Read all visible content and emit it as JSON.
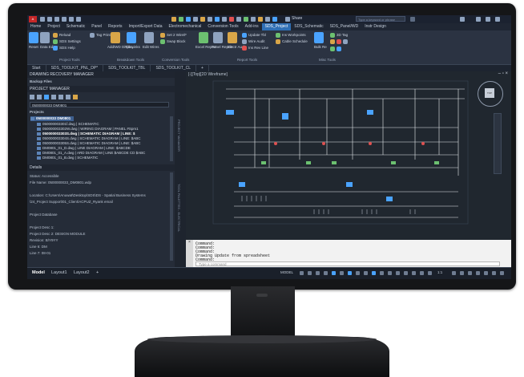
{
  "app": {
    "title_share": "Share",
    "search_placeholder": "Type a keyword or phrase"
  },
  "ribbon_tabs": [
    "Home",
    "Project",
    "Schematic",
    "Panel",
    "Reports",
    "Import/Export Data",
    "Electromechanical",
    "Conversion Tools",
    "Add-ins",
    "SDS_Project",
    "SDS_Schematic",
    "SDS_Panel/WD",
    "Instr Design"
  ],
  "active_ribbon_tab_index": 9,
  "ribbon": {
    "group_titles": [
      "Project Tools",
      "Breakdown Tools",
      "Conversion Tools",
      "Report Tools",
      "Misc Tools"
    ],
    "labels": [
      "Reset",
      "Data Editor",
      "Reload",
      "SDS Settings",
      "SDS Help",
      "Tag Print",
      "Add/WD Display",
      "Tile Links",
      "Edit Wires",
      "Set 2 Wire/F",
      "Swap Block",
      "Excel Report",
      "Panel Report",
      "Electr Audit",
      "Update Tbl",
      "Wire Audit",
      "Ins Rev Line",
      "Ins Workpoints",
      "Cable Schedule",
      "Bulk Re",
      "3D Tag"
    ]
  },
  "doc_tabs": [
    "Start",
    "SDS_TOOLKIT_PNL_DP*",
    "SDS_TOOLKIT_TBL",
    "SDS_TOOLKIT_CL",
    "+"
  ],
  "left_panel": {
    "recovery_title": "DRAWING RECOVERY MANAGER",
    "recovery_label": "Backup Files",
    "project_manager_title": "PROJECT MANAGER",
    "project_dropdown": "0500000033 DM0801",
    "projects_header": "Projects",
    "project_root": "0500000033 DM0801",
    "tree_rows": [
      "050000003301f.dwg | SCHEMATIC",
      "050000003302W.dwg | WIRING DIAGRAM | PANEL #Spm1",
      "050000003303S.dwg | SCHEMATIC DIAGRAM | LINE: $",
      "050000003304S.dwg | SCHEMATIC DIAGRAM | LINE: $ABC",
      "050000003305S.dwg | SCHEMATIC DIAGRAM | LINE: $ABC",
      "DM0801_01_D.dwg | LINE DIAGRAM | LINE: $ABCDE",
      "DM0801_01_A.dwg | ARD DIAGRAM | LINE $ABCDE CD $ABC",
      "DM0801_01_B.dwg | SCHEMATIC"
    ],
    "details_header": "Details",
    "details_lines": [
      "Status: Accessible",
      "File Name: 0500000033_DM0801.wdp",
      "",
      "Location: C:\\Users\\Anuwat\\Desktop\\SDS\\DS - Spatial Business Systems",
      "\\24_Project Support\\01_Client\\ACPUZ_Ryank email",
      "",
      "Project Database",
      "",
      "Project Desc 1:",
      "Project Desc 2: DESIGN MODULE",
      "Revision: B/Y9YY",
      "Line 6: DM",
      "Line 7: 08-01"
    ]
  },
  "palette_labels": [
    "PROJECT MANAGER",
    "TOOL PALETTES - ELECTRICAL"
  ],
  "drawing": {
    "view_label": "[-][Top][2D Wireframe]",
    "viewcube": {
      "top": "N",
      "face": "TOP",
      "left": "W",
      "right": "E",
      "bottom": "S"
    }
  },
  "command_window": {
    "history": [
      "Command:",
      "Command:",
      "Command:",
      "Drawing Update from spreadsheet",
      "Command:"
    ],
    "placeholder": "Type a command"
  },
  "status_bar": {
    "layout_tabs": [
      "Model",
      "Layout1",
      "Layout2",
      "+"
    ],
    "active_tab_index": 0,
    "space_label": "MODEL",
    "scale": "1:1"
  },
  "colors": {
    "active_tab": "#2f6fb5",
    "drawing_bg": "#20272f",
    "wire": "#e8ecf0",
    "accent_blue": "#4aa3ff",
    "accent_green": "#6cc070",
    "accent_red": "#e05050"
  }
}
